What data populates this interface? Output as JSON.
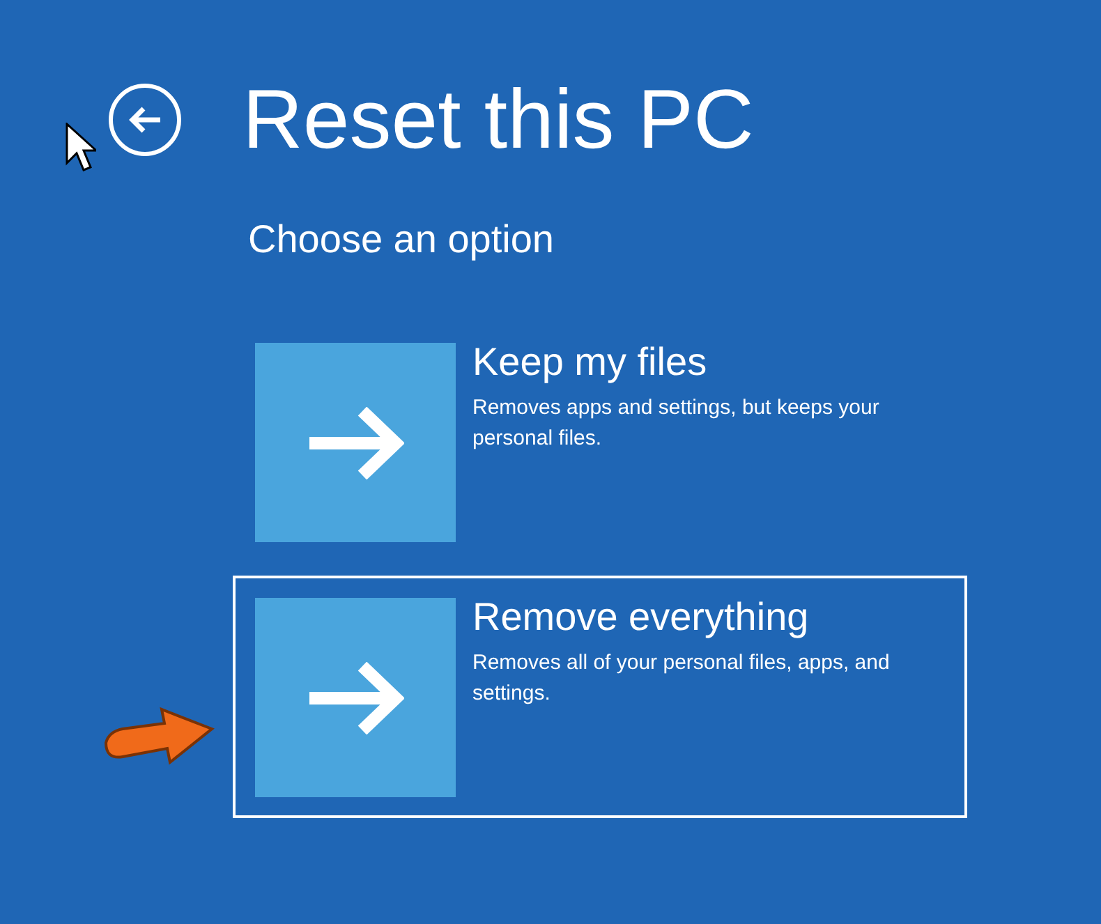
{
  "header": {
    "title": "Reset this PC",
    "subtitle": "Choose an option"
  },
  "options": [
    {
      "title": "Keep my files",
      "description": "Removes apps and settings, but keeps your personal files.",
      "selected": false
    },
    {
      "title": "Remove everything",
      "description": "Removes all of your personal files, apps, and settings.",
      "selected": true
    }
  ]
}
